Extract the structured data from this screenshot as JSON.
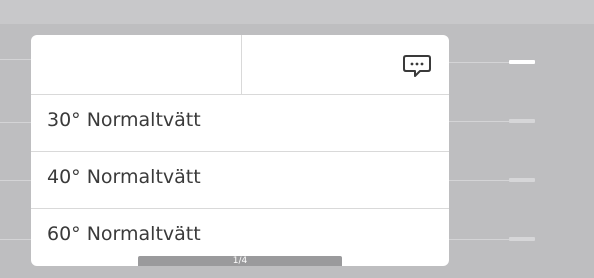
{
  "header": {
    "left_title": "",
    "right_icon": "message-bubble-icon"
  },
  "programs": [
    {
      "label": "30° Normaltvätt"
    },
    {
      "label": "40° Normaltvätt"
    },
    {
      "label": "60° Normaltvätt"
    }
  ],
  "pager": {
    "label": "1/4",
    "current_page": 1,
    "total_pages": 4
  },
  "side_indicator": {
    "count": 4,
    "active_index": 0
  },
  "colors": {
    "background": "#c8c8ca",
    "panel": "#ffffff",
    "divider": "#d9d9d9",
    "text": "#3a3a3a",
    "pager": "#9a9a9c"
  }
}
